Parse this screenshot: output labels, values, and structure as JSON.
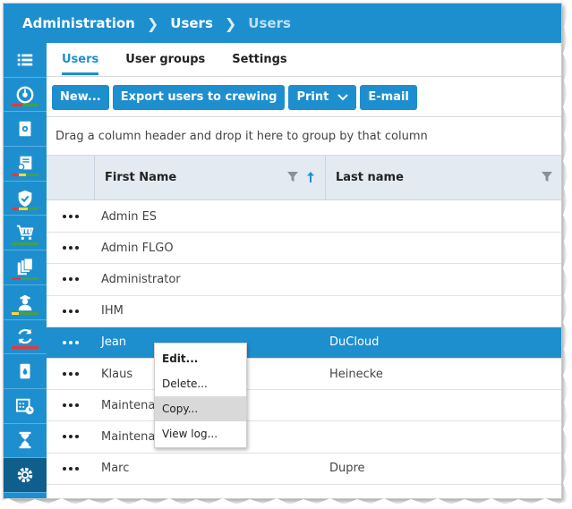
{
  "breadcrumb": [
    "Administration",
    "Users",
    "Users"
  ],
  "sidebar": {
    "items": [
      {
        "icon": "list-icon",
        "status": []
      },
      {
        "icon": "gauge-icon",
        "status": [
          "#e53935",
          "#43a047",
          "#43a047"
        ]
      },
      {
        "icon": "settings-doc-icon",
        "status": []
      },
      {
        "icon": "certificate-icon",
        "status": [
          "#e53935",
          "#fdd835",
          "#43a047"
        ]
      },
      {
        "icon": "shield-check-icon",
        "status": [
          "#e53935",
          "#fdd835",
          "#43a047"
        ]
      },
      {
        "icon": "cart-icon",
        "status": [
          "#43a047",
          "#43a047",
          "#43a047"
        ]
      },
      {
        "icon": "documents-icon",
        "status": [
          "#e53935",
          "#43a047",
          "#43a047"
        ]
      },
      {
        "icon": "officer-icon",
        "status": [
          "#fdd835",
          "#43a047",
          "#43a047"
        ]
      },
      {
        "icon": "sync-icon",
        "status": [
          "#e53935",
          "#e53935",
          "#e53935"
        ]
      },
      {
        "icon": "tank-icon",
        "status": []
      },
      {
        "icon": "calendar-clock-icon",
        "status": []
      },
      {
        "icon": "hourglass-icon",
        "status": []
      },
      {
        "icon": "gear-icon",
        "status": []
      }
    ]
  },
  "tabs": [
    {
      "label": "Users",
      "active": true
    },
    {
      "label": "User groups",
      "active": false
    },
    {
      "label": "Settings",
      "active": false
    }
  ],
  "toolbar": {
    "new_label": "New...",
    "export_label": "Export users to crewing",
    "print_label": "Print",
    "email_label": "E-mail"
  },
  "group_hint": "Drag a column header and drop it here to group by that column",
  "columns": {
    "first_name": "First Name",
    "last_name": "Last name"
  },
  "rows": [
    {
      "first": "Admin ES",
      "last": ""
    },
    {
      "first": "Admin FLGO",
      "last": ""
    },
    {
      "first": "Administrator",
      "last": ""
    },
    {
      "first": "IHM",
      "last": ""
    },
    {
      "first": "Jean",
      "last": "DuCloud",
      "selected": true
    },
    {
      "first": "Klaus",
      "last": "Heinecke"
    },
    {
      "first": "Maintena",
      "last": ""
    },
    {
      "first": "Maintena",
      "last": ""
    },
    {
      "first": "Marc",
      "last": "Dupre"
    }
  ],
  "context_menu": {
    "edit": "Edit...",
    "delete": "Delete...",
    "copy": "Copy...",
    "view_log": "View log..."
  },
  "colors": {
    "accent": "#1d8fcf",
    "dark_accent": "#0f5f8d"
  }
}
